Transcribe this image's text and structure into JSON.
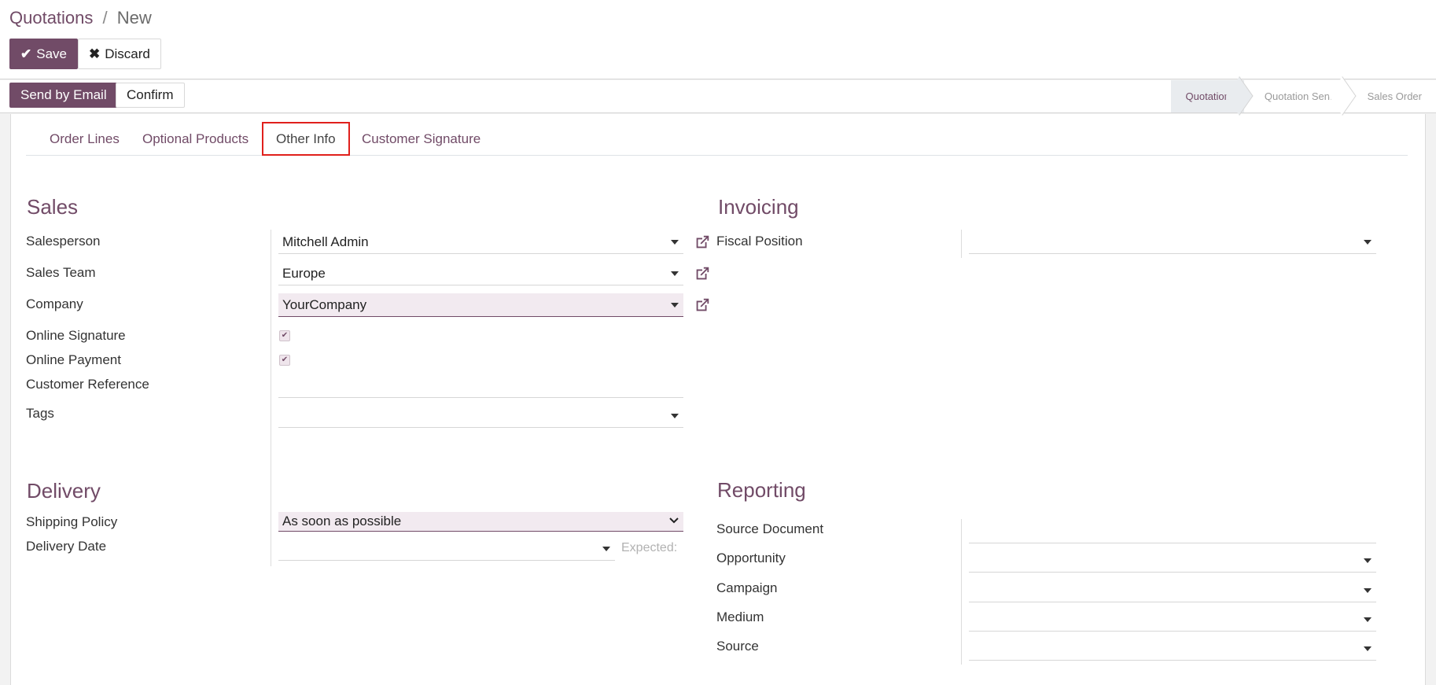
{
  "breadcrumb": {
    "parent": "Quotations",
    "separator": "/",
    "current": "New"
  },
  "toolbar": {
    "save_label": "Save",
    "discard_label": "Discard"
  },
  "statusbar": {
    "send_email_label": "Send by Email",
    "confirm_label": "Confirm",
    "stages": [
      "Quotation",
      "Quotation Sent",
      "Sales Order"
    ],
    "active_stage": "Quotation"
  },
  "tabs": [
    "Order Lines",
    "Optional Products",
    "Other Info",
    "Customer Signature"
  ],
  "active_tab": "Other Info",
  "sales": {
    "title": "Sales",
    "salesperson_label": "Salesperson",
    "salesperson_value": "Mitchell Admin",
    "team_label": "Sales Team",
    "team_value": "Europe",
    "company_label": "Company",
    "company_value": "YourCompany",
    "online_signature_label": "Online Signature",
    "online_signature_checked": true,
    "online_payment_label": "Online Payment",
    "online_payment_checked": true,
    "customer_reference_label": "Customer Reference",
    "customer_reference_value": "",
    "tags_label": "Tags",
    "tags_value": ""
  },
  "invoicing": {
    "title": "Invoicing",
    "fiscal_position_label": "Fiscal Position",
    "fiscal_position_value": ""
  },
  "delivery": {
    "title": "Delivery",
    "shipping_policy_label": "Shipping Policy",
    "shipping_policy_value": "As soon as possible",
    "delivery_date_label": "Delivery Date",
    "delivery_date_value": "",
    "expected_label": "Expected:"
  },
  "reporting": {
    "title": "Reporting",
    "source_document_label": "Source Document",
    "opportunity_label": "Opportunity",
    "campaign_label": "Campaign",
    "medium_label": "Medium",
    "source_label": "Source"
  },
  "colors": {
    "brand": "#714b67",
    "highlight_tab_border": "#e0201c"
  },
  "icons": [
    "check-icon",
    "times-icon",
    "external-link-icon",
    "caret-down-icon",
    "checkbox-check-icon"
  ]
}
